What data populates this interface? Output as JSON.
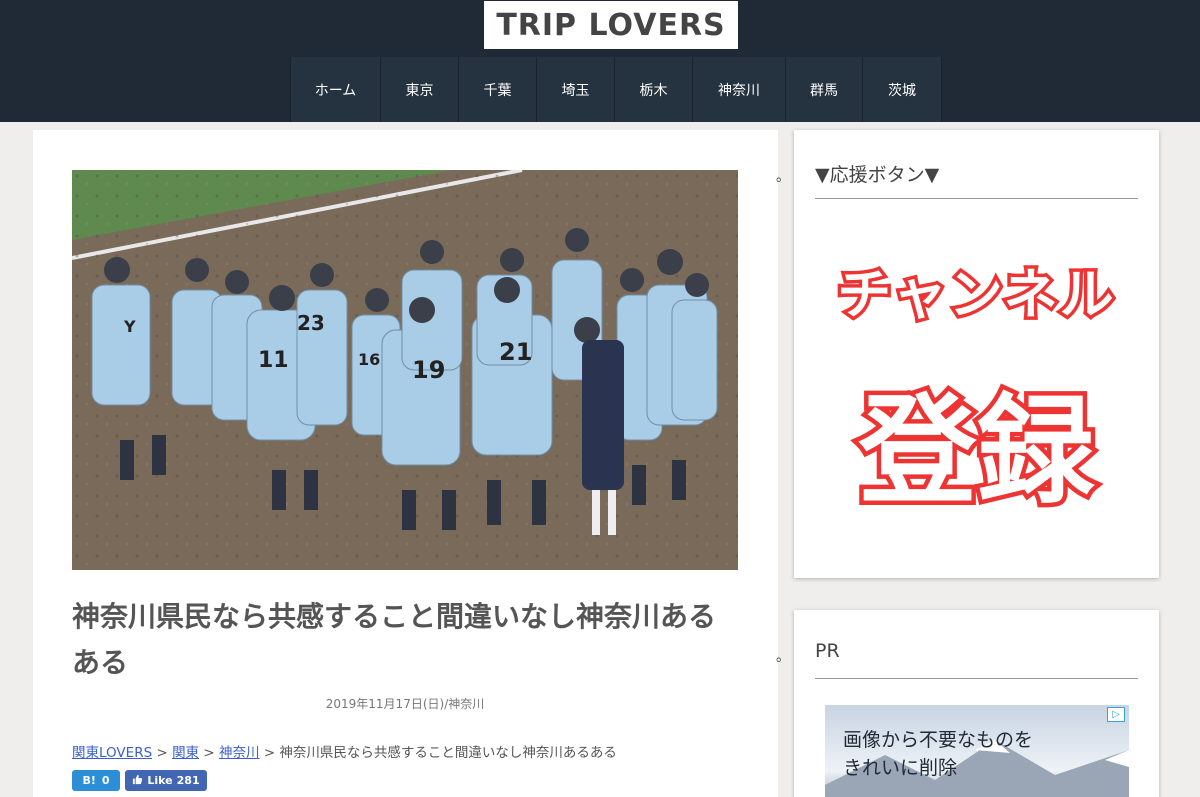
{
  "header": {
    "logo_text": "TRIP LOVERS",
    "nav": [
      "ホーム",
      "東京",
      "千葉",
      "埼玉",
      "栃木",
      "神奈川",
      "群馬",
      "茨城"
    ]
  },
  "article": {
    "title": "神奈川県民なら共感すること間違いなし神奈川あるある",
    "meta": "2019年11月17日(日)/神奈川",
    "breadcrumb": {
      "items": [
        "関東LOVERS",
        "関東",
        "神奈川"
      ],
      "separator": ">",
      "current": "神奈川県民なら共感すること間違いなし神奈川あるある"
    },
    "share": {
      "hatena_label": "B!",
      "hatena_count": "0",
      "fb_label": "Like",
      "fb_count": "281"
    },
    "hero": {
      "jersey_numbers": [
        "11",
        "23",
        "16",
        "19",
        "21"
      ],
      "cap_letter": "Y"
    }
  },
  "sidebar": {
    "bullet": "。",
    "widget1": {
      "title": "▼応援ボタン▼",
      "banner_line1": "チャンネル",
      "banner_line2": "登録"
    },
    "widget2": {
      "title": "PR",
      "ad_line1": "画像から不要なものを",
      "ad_line2": "きれいに削除",
      "ad_badge": "▷"
    }
  },
  "colors": {
    "header_bg": "#1f2a36",
    "link": "#3a5fcd",
    "banner_red": "#ee3333",
    "hatena": "#2c8fd6",
    "facebook": "#4267b2"
  }
}
